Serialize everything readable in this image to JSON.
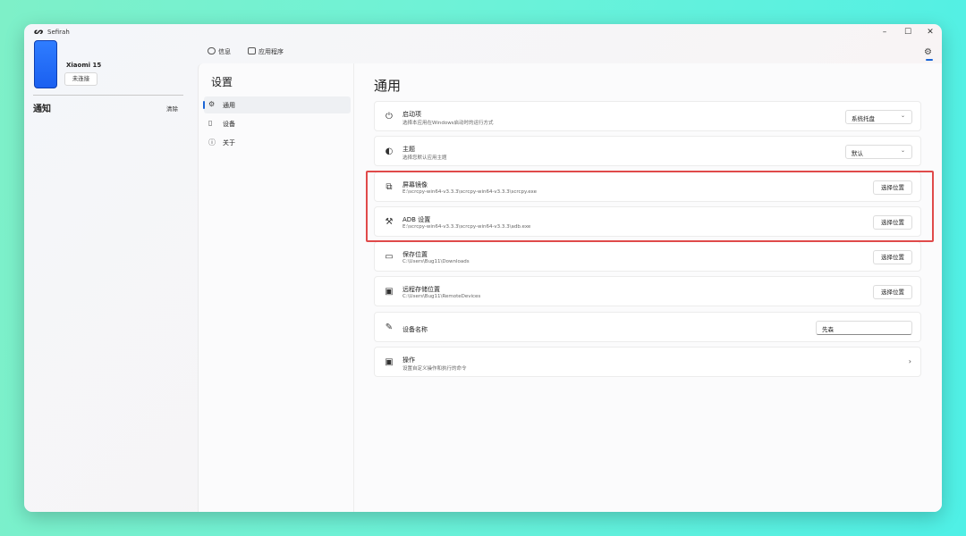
{
  "window": {
    "app_title": "Sefirah",
    "logo_glyph": "ᔕ",
    "controls": {
      "minimize": "–",
      "maximize": "☐",
      "close": "✕"
    }
  },
  "device": {
    "name": "Xiaomi 15",
    "status_button": "未连接"
  },
  "notifications": {
    "title": "通知",
    "clear_label": "清除"
  },
  "top_tabs": [
    {
      "label": "信息",
      "icon": "chat-icon"
    },
    {
      "label": "应用程序",
      "icon": "apps-icon"
    }
  ],
  "settings_icon": "gear-icon",
  "settings_nav": {
    "title": "设置",
    "items": [
      {
        "label": "通用",
        "icon": "gear-icon",
        "active": true
      },
      {
        "label": "设备",
        "icon": "phone-icon",
        "active": false
      },
      {
        "label": "关于",
        "icon": "info-icon",
        "active": false
      }
    ]
  },
  "general": {
    "title": "通用",
    "cards": [
      {
        "id": "startup",
        "title": "启动项",
        "subtitle": "选择本应用在Windows启动时的运行方式",
        "control": "select",
        "value": "系统托盘",
        "icon": "power-icon"
      },
      {
        "id": "theme",
        "title": "主题",
        "subtitle": "选择您默认应用主题",
        "control": "select",
        "value": "默认",
        "icon": "palette-icon"
      },
      {
        "id": "screen-mirror",
        "title": "屏幕镜像",
        "subtitle": "E:\\scrcpy-win64-v3.3.3\\scrcpy-win64-v3.3.3\\scrcpy.exe",
        "control": "button",
        "value": "选择位置",
        "icon": "screen-cast-icon"
      },
      {
        "id": "adb",
        "title": "ADB 设置",
        "subtitle": "E:\\scrcpy-win64-v3.3.3\\scrcpy-win64-v3.3.3\\adb.exe",
        "control": "button",
        "value": "选择位置",
        "icon": "tools-icon"
      },
      {
        "id": "save-location",
        "title": "保存位置",
        "subtitle": "C:\\Users\\Bug11\\Downloads",
        "control": "button",
        "value": "选择位置",
        "icon": "folder-icon"
      },
      {
        "id": "remote-storage",
        "title": "远程存储位置",
        "subtitle": "C:\\Users\\Bug11\\RemoteDevices",
        "control": "button",
        "value": "选择位置",
        "icon": "folder-link-icon"
      },
      {
        "id": "device-name",
        "title": "设备名称",
        "subtitle": "",
        "control": "text",
        "value": "先森",
        "icon": "pen-icon"
      },
      {
        "id": "actions",
        "title": "操作",
        "subtitle": "设置自定义操作和执行的命令",
        "control": "chevron",
        "value": "",
        "icon": "folder-gear-icon"
      }
    ]
  },
  "colors": {
    "accent": "#1a64d6",
    "highlight_border": "#e04a4a",
    "phone_screen": "#2f7dff"
  }
}
